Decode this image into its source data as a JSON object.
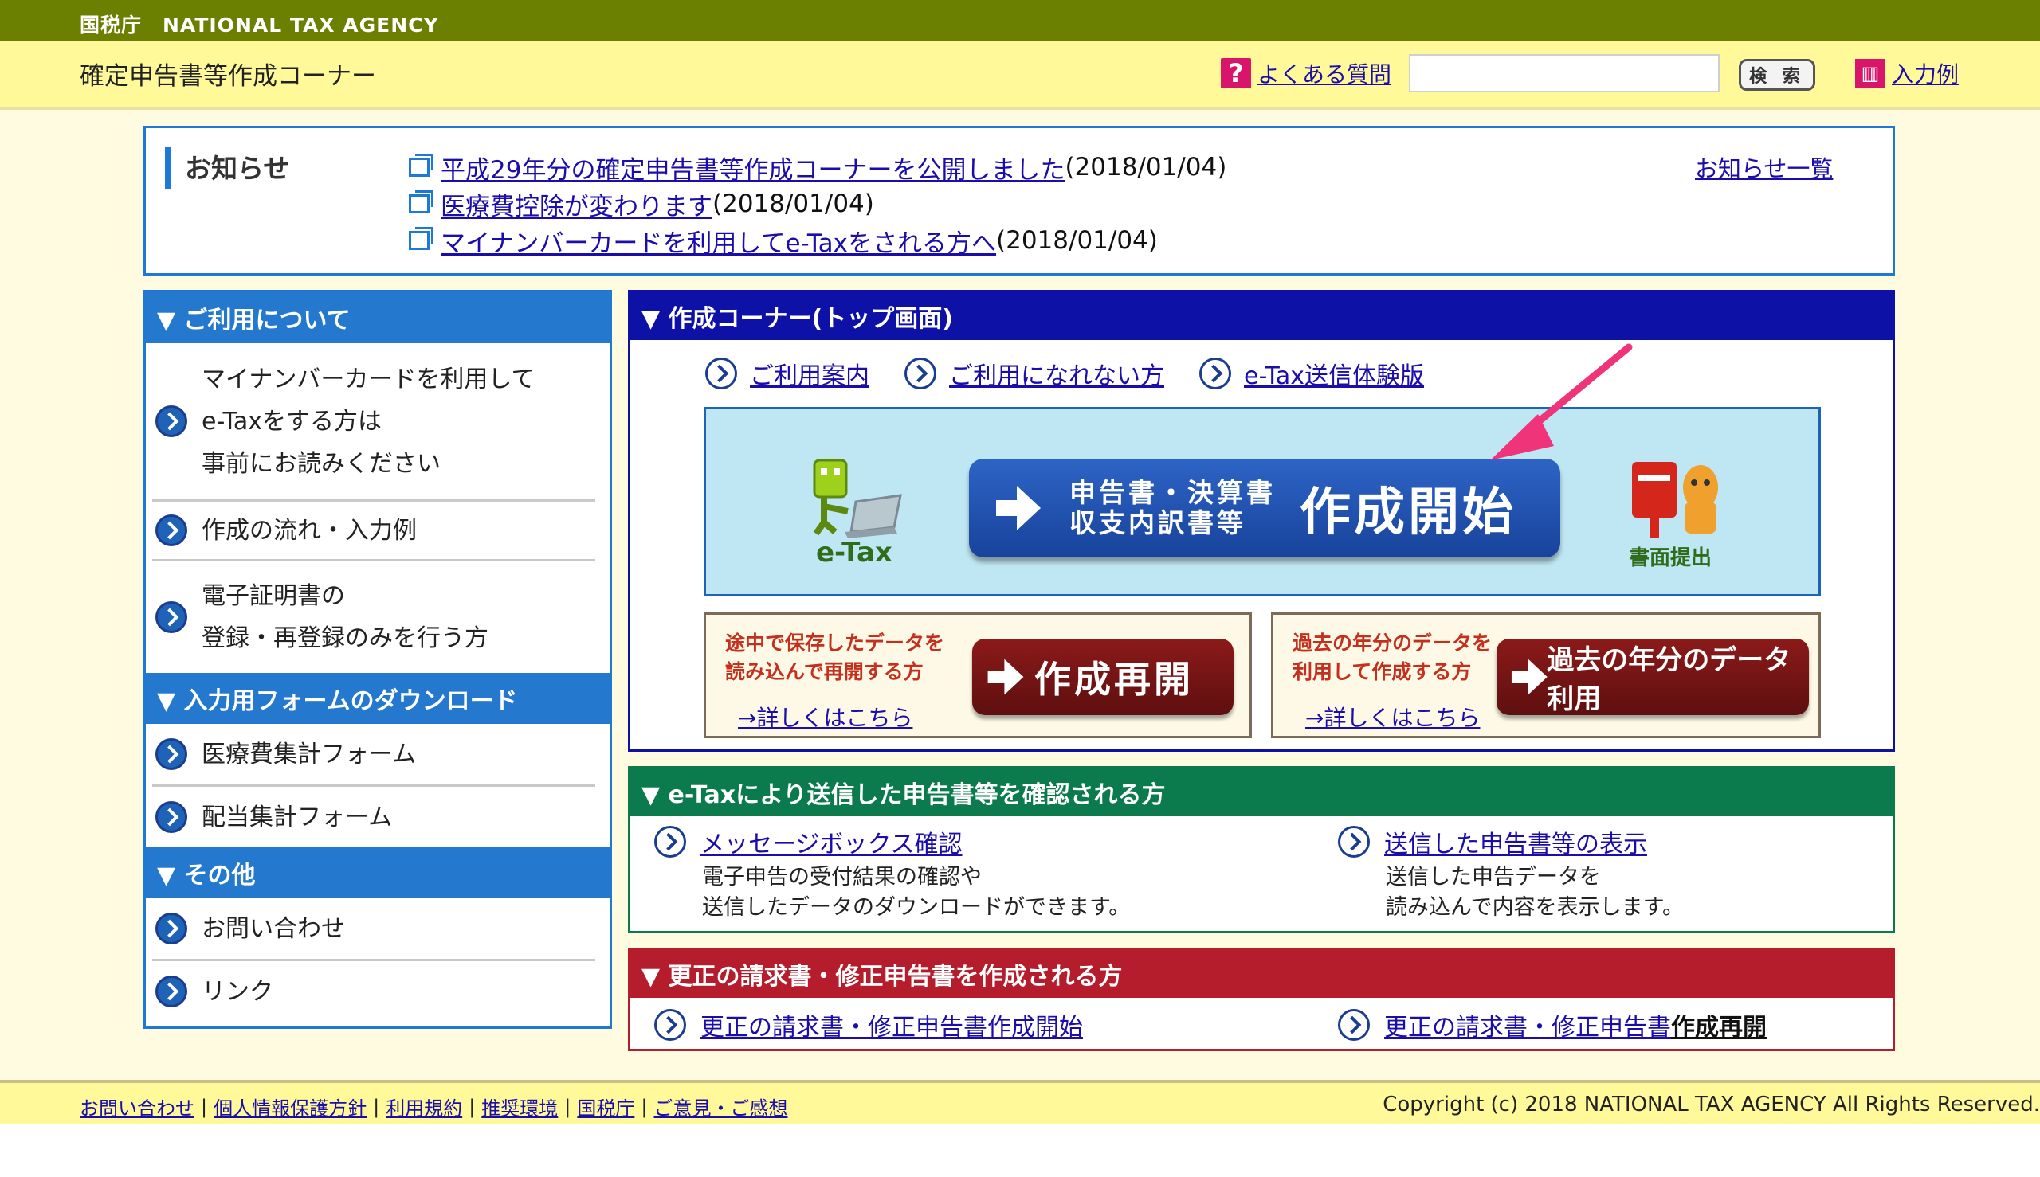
{
  "agency": "国税庁　NATIONAL TAX AGENCY",
  "header": {
    "title": "確定申告書等作成コーナー",
    "faq": "よくある質問",
    "search_placeholder": "",
    "search_button": "検 索",
    "example": "入力例"
  },
  "notice": {
    "heading": "お知らせ",
    "all_link": "お知らせ一覧",
    "items": [
      {
        "link": "平成29年分の確定申告書等作成コーナーを公開しました",
        "date": "(2018/01/04)"
      },
      {
        "link": "医療費控除が変わります",
        "date": "(2018/01/04)"
      },
      {
        "link": "マイナンバーカードを利用してe-Taxをされる方へ",
        "date": " (2018/01/04)"
      }
    ]
  },
  "sidebar": {
    "sections": [
      {
        "heading": "▼ ご利用について",
        "items": [
          {
            "lines": [
              "マイナンバーカードを利用して",
              "e-Taxをする方は",
              "事前にお読みください"
            ]
          },
          {
            "lines": [
              "作成の流れ・入力例"
            ]
          },
          {
            "lines": [
              "電子証明書の",
              "登録・再登録のみを行う方"
            ]
          }
        ]
      },
      {
        "heading": "▼ 入力用フォームのダウンロード",
        "items": [
          {
            "lines": [
              "医療費集計フォーム"
            ]
          },
          {
            "lines": [
              "配当集計フォーム"
            ]
          }
        ]
      },
      {
        "heading": "▼ その他",
        "items": [
          {
            "lines": [
              "お問い合わせ"
            ]
          },
          {
            "lines": [
              "リンク"
            ]
          }
        ]
      }
    ]
  },
  "main": {
    "heading": "▼ 作成コーナー(トップ画面)",
    "links": [
      "ご利用案内",
      "ご利用になれない方",
      "e-Tax送信体験版"
    ],
    "etax_label": "e-Tax",
    "start_small": [
      "申告書・決算書",
      "収支内訳書等"
    ],
    "start_big": "作成開始",
    "paper_label": "書面提出",
    "resume": {
      "text": [
        "途中で保存したデータを",
        "読み込んで再開する方"
      ],
      "button": "作成再開",
      "more": "→詳しくはこちら"
    },
    "past": {
      "text": [
        "過去の年分のデータを",
        "利用して作成する方"
      ],
      "button": "過去の年分のデータ利用",
      "more": "→詳しくはこちら"
    }
  },
  "confirm": {
    "heading": "▼ e-Taxにより送信した申告書等を確認される方",
    "left": {
      "link": "メッセージボックス確認",
      "desc": [
        "電子申告の受付結果の確認や",
        "送信したデータのダウンロードができます。"
      ]
    },
    "right": {
      "link": "送信した申告書等の表示",
      "desc": [
        "送信した申告データを",
        "読み込んで内容を表示します。"
      ]
    }
  },
  "correction": {
    "heading": "▼ 更正の請求書・修正申告書を作成される方",
    "left_link": "更正の請求書・修正申告書作成開始",
    "right_link": "更正の請求書・修正申告書",
    "right_suffix": "作成再開"
  },
  "footer": {
    "links": [
      "お問い合わせ",
      "個人情報保護方針",
      "利用規約",
      "推奨環境",
      "国税庁",
      "ご意見・ご感想"
    ],
    "copyright": "Copyright (c) 2018 NATIONAL TAX AGENCY All Rights Reserved."
  },
  "colors": {
    "topbar": "#6b7f00",
    "header": "#fff99a",
    "navy": "#0d11a6",
    "green": "#0b7a4c",
    "red": "#b51d2d",
    "annotation": "#f0347a"
  }
}
